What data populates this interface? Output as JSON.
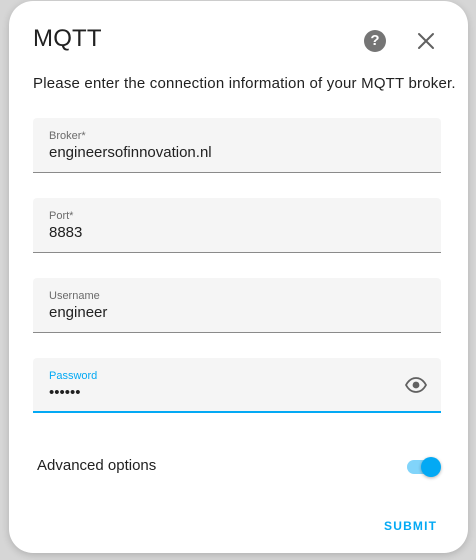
{
  "dialog": {
    "title": "MQTT",
    "intro": "Please enter the connection information of your MQTT broker."
  },
  "fields": [
    {
      "label": "Broker*",
      "value": "engineersofinnovation.nl"
    },
    {
      "label": "Port*",
      "value": "8883"
    },
    {
      "label": "Username",
      "value": "engineer"
    },
    {
      "label": "Password",
      "value": "••••••"
    }
  ],
  "advanced": {
    "label": "Advanced options",
    "enabled": true
  },
  "actions": {
    "submit_label": "SUBMIT"
  },
  "colors": {
    "accent": "#03a9f4",
    "accent_light": "#81d4fa",
    "field_bg": "#f5f5f5",
    "text": "#212121"
  },
  "icons": {
    "help": "help-circle-icon",
    "close": "close-icon",
    "password_visibility": "eye-icon"
  }
}
